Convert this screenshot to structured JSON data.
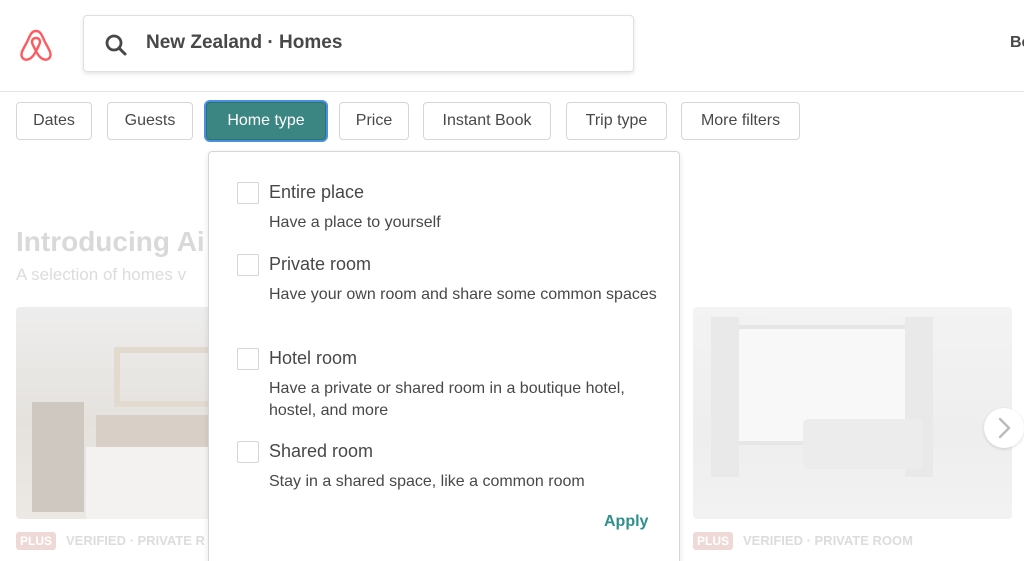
{
  "header": {
    "search_value": "New Zealand · Homes",
    "right_text": "Be"
  },
  "filters": [
    {
      "label": "Dates"
    },
    {
      "label": "Guests"
    },
    {
      "label": "Home type",
      "active": true
    },
    {
      "label": "Price"
    },
    {
      "label": "Instant Book"
    },
    {
      "label": "Trip type"
    },
    {
      "label": "More filters"
    }
  ],
  "background": {
    "title": "Introducing Ai",
    "subtitle": "A selection of homes v",
    "cards": [
      {
        "badge": "PLUS",
        "verified": "VERIFIED · PRIVATE R"
      },
      {
        "badge": "PLUS",
        "verified": "VERIFIED · PRIVATE ROOM"
      }
    ]
  },
  "home_type_menu": {
    "options": [
      {
        "title": "Entire place",
        "description": "Have a place to yourself",
        "checked": false
      },
      {
        "title": "Private room",
        "description": "Have your own room and share some common spaces",
        "checked": false
      },
      {
        "title": "Hotel room",
        "description": "Have a private or shared room in a boutique hotel, hostel, and more",
        "checked": false
      },
      {
        "title": "Shared room",
        "description": "Stay in a shared space, like a common room",
        "checked": false
      }
    ],
    "apply_label": "Apply"
  },
  "colors": {
    "brand": "#ff5a5f",
    "active_filter": "#3b8683",
    "apply": "#2f8f8a"
  },
  "icons": {
    "logo": "airbnb-logo",
    "search": "search-icon",
    "next": "chevron-right-icon"
  }
}
